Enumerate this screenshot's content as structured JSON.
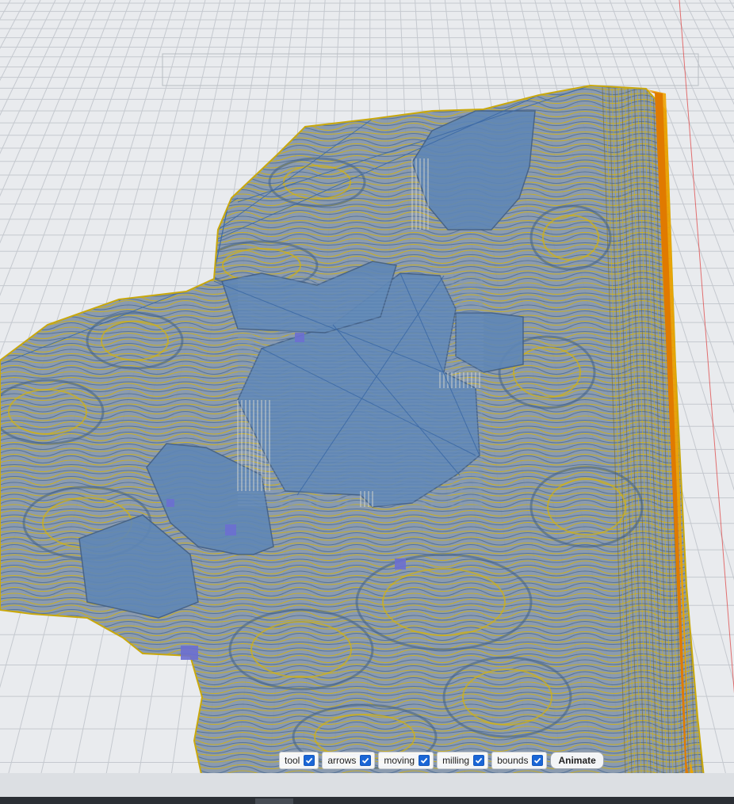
{
  "scene": {
    "background_color": "#e9ebee",
    "grid_color": "#c5c9cf",
    "toolpath_color": "#d1b20f",
    "surface_color": "#5f87b6",
    "bounds_edge_color": "#f08a00",
    "tool_marker_color": "#6b6fd0"
  },
  "controls": {
    "tool": {
      "label": "tool",
      "checked": true
    },
    "arrows": {
      "label": "arrows",
      "checked": true
    },
    "moving": {
      "label": "moving",
      "checked": true
    },
    "milling": {
      "label": "milling",
      "checked": true
    },
    "bounds": {
      "label": "bounds",
      "checked": true
    },
    "animate_label": "Animate"
  },
  "checkbox_icon": "checkmark-icon"
}
